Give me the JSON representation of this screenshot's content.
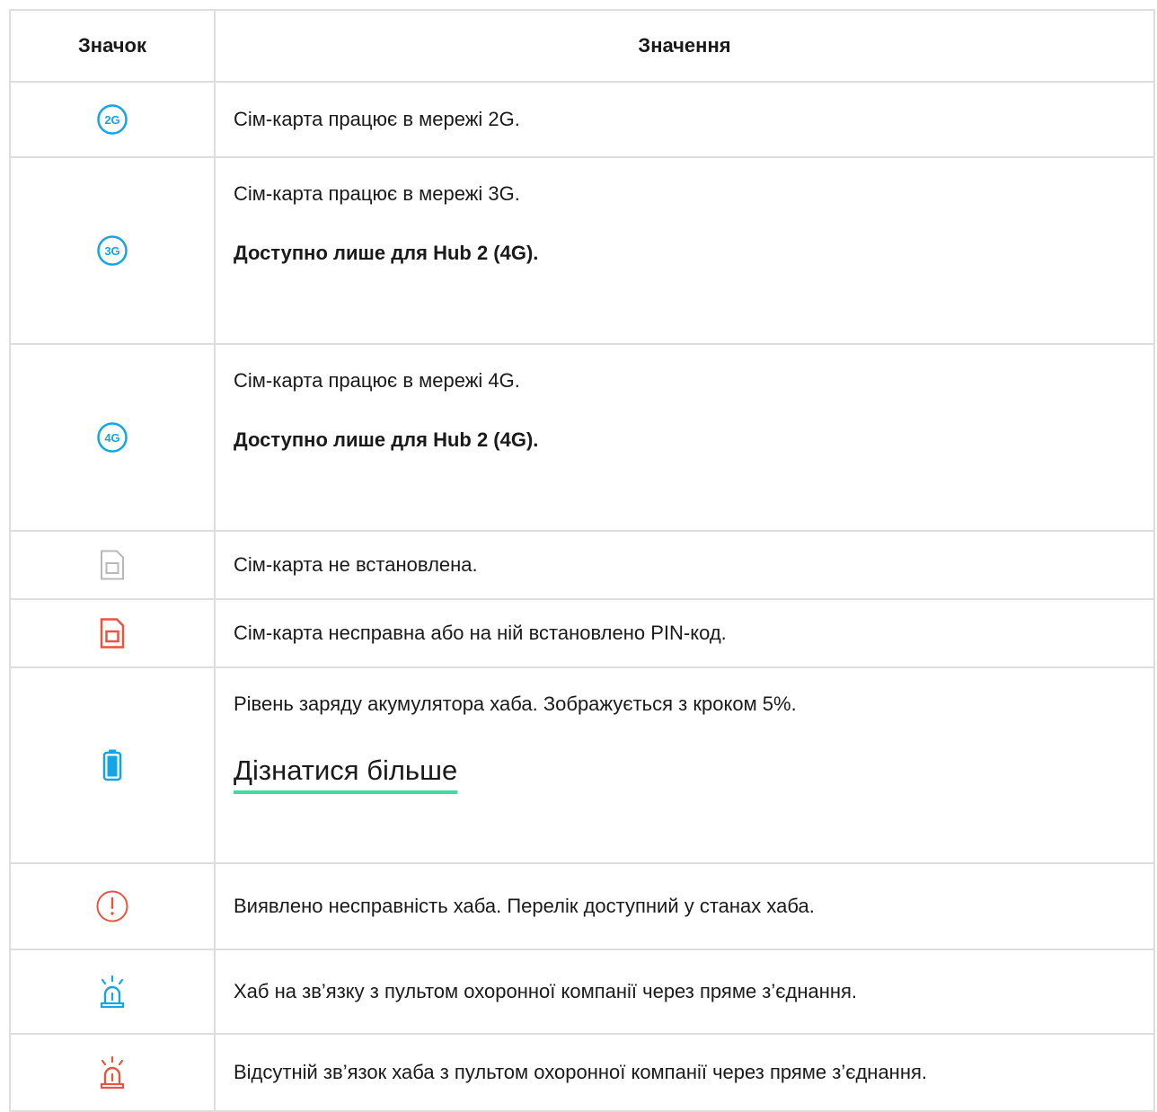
{
  "header": {
    "col_icon": "Значок",
    "col_meaning": "Значення"
  },
  "colors": {
    "blue": "#14a5e5",
    "red": "#e8553f",
    "gray": "#b8b8b8",
    "link_underline": "#3edca0"
  },
  "rows": [
    {
      "icon": "network-2g-icon",
      "badge": "2G",
      "text": "Сім-карта працює в мережі 2G."
    },
    {
      "icon": "network-3g-icon",
      "badge": "3G",
      "text": "Сім-карта працює в мережі 3G.",
      "note": "Доступно лише для Hub 2 (4G)."
    },
    {
      "icon": "network-4g-icon",
      "badge": "4G",
      "text": "Сім-карта працює в мережі 4G.",
      "note": "Доступно лише для Hub 2 (4G)."
    },
    {
      "icon": "sim-card-missing-icon",
      "text": "Сім-карта не встановлена."
    },
    {
      "icon": "sim-card-error-icon",
      "text": "Сім-карта несправна або на ній встановлено PIN-код."
    },
    {
      "icon": "battery-icon",
      "text": "Рівень заряду акумулятора хаба. Зображується з кроком 5%.",
      "link": "Дізнатися більше"
    },
    {
      "icon": "warning-icon",
      "text": "Виявлено несправність хаба. Перелік доступний у станах хаба."
    },
    {
      "icon": "alarm-connected-icon",
      "text": "Хаб на зв’язку з пультом охоронної компанії через пряме з’єднання."
    },
    {
      "icon": "alarm-disconnected-icon",
      "text": "Відсутній зв’язок хаба з пультом охоронної компанії через пряме з’єднання."
    }
  ]
}
